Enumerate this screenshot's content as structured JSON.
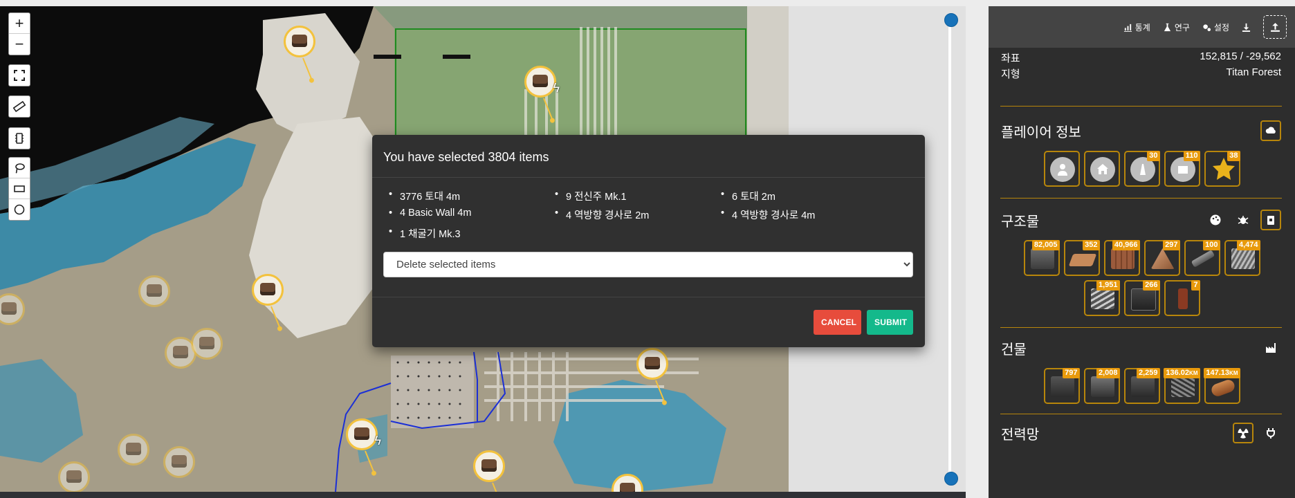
{
  "map": {
    "controls": {
      "zoom_in": "+",
      "zoom_out": "−"
    }
  },
  "modal": {
    "title": "You have selected 3804 items",
    "items": [
      "3776 토대 4m",
      "9 전신주 Mk.1",
      "6 토대 2m",
      "4 Basic Wall 4m",
      "4 역방향 경사로 2m",
      "4 역방향 경사로 4m",
      "1 채굴기 Mk.3"
    ],
    "select": {
      "selected": "Delete selected items"
    },
    "cancel_label": "CANCEL",
    "submit_label": "SUBMIT"
  },
  "panel": {
    "toolbar": {
      "stats_label": "통계",
      "research_label": "연구",
      "settings_label": "설정"
    },
    "coords_label": "좌표",
    "coords_value": "152,815 / -29,562",
    "terrain_label": "지형",
    "terrain_value": "Titan Forest",
    "player_title": "플레이어 정보",
    "player_badges": [
      "30",
      "110",
      "38"
    ],
    "structures_title": "구조물",
    "structure_counts": [
      "82,005",
      "352",
      "40,966",
      "297",
      "100",
      "4,474",
      "1,951",
      "266",
      "7"
    ],
    "buildings_title": "건물",
    "building_counts": [
      "797",
      "2,008",
      "2,259",
      "136.02",
      "147.13"
    ],
    "building_units": [
      "KM",
      "KM"
    ],
    "power_title": "전력망"
  },
  "colors": {
    "accent_gold": "#b8860b",
    "badge_orange": "#e89a0c",
    "cancel_red": "#e74c3c",
    "submit_green": "#14b98b",
    "selection_green": "#1f8a1f"
  }
}
